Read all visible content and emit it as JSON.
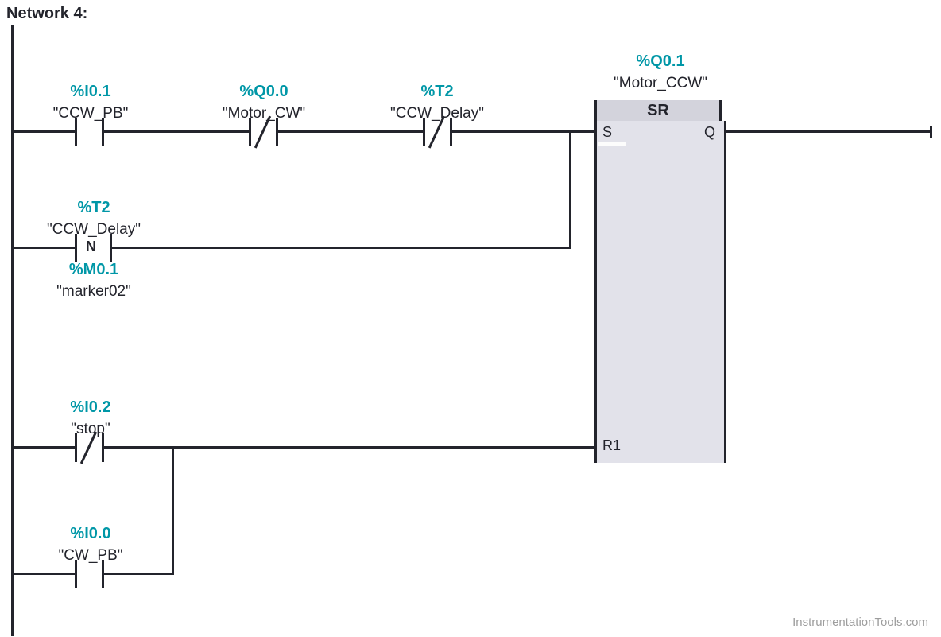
{
  "network": {
    "title": "Network 4:"
  },
  "elements": {
    "ccw_pb": {
      "addr": "%I0.1",
      "name": "\"CCW_PB\""
    },
    "motor_cw": {
      "addr": "%Q0.0",
      "name": "\"Motor_CW\""
    },
    "ccw_delay": {
      "addr": "%T2",
      "name": "\"CCW_Delay\""
    },
    "ccw_delay2": {
      "addr": "%T2",
      "name": "\"CCW_Delay\""
    },
    "marker02": {
      "addr": "%M0.1",
      "name": "\"marker02\""
    },
    "stop": {
      "addr": "%I0.2",
      "name": "\"stop\""
    },
    "cw_pb": {
      "addr": "%I0.0",
      "name": "\"CW_PB\""
    },
    "motor_ccw": {
      "addr": "%Q0.1",
      "name": "\"Motor_CCW\""
    }
  },
  "block": {
    "type": "SR",
    "pin_s": "S",
    "pin_q": "Q",
    "pin_r1": "R1"
  },
  "edge": {
    "n_label": "N"
  },
  "watermark": "InstrumentationTools.com"
}
